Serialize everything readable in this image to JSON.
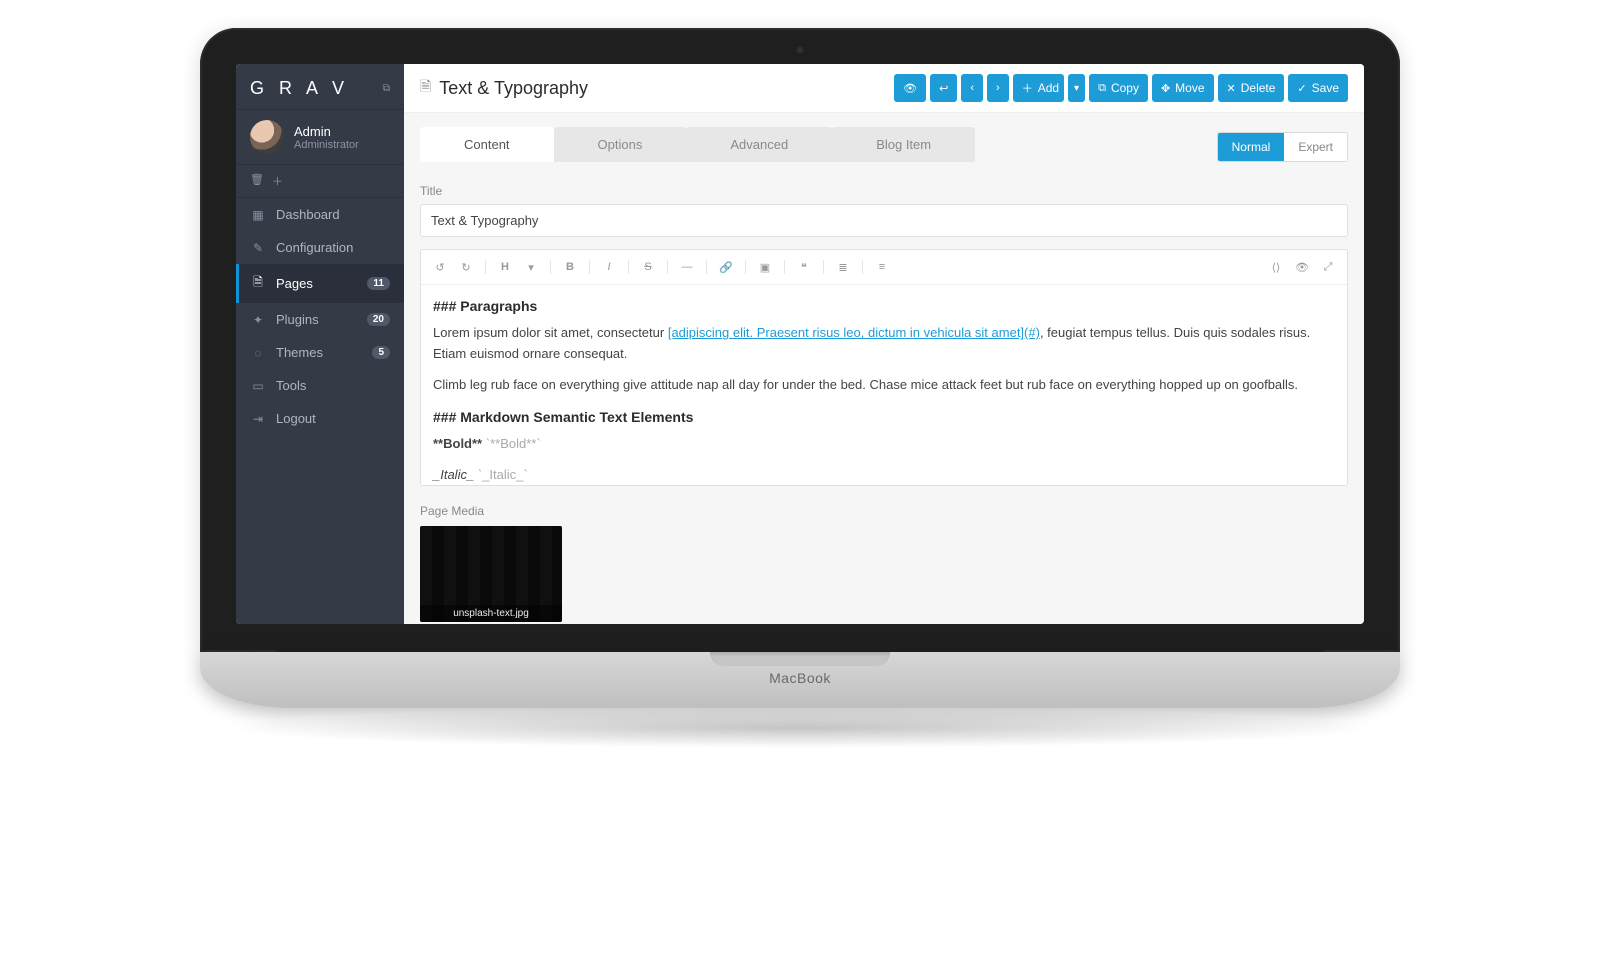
{
  "brand": "G R A V",
  "user": {
    "name": "Admin",
    "role": "Administrator"
  },
  "nav": {
    "dashboard": "Dashboard",
    "configuration": "Configuration",
    "pages": "Pages",
    "pages_count": "11",
    "plugins": "Plugins",
    "plugins_count": "20",
    "themes": "Themes",
    "themes_count": "5",
    "tools": "Tools",
    "logout": "Logout"
  },
  "header": {
    "title": "Text & Typography",
    "buttons": {
      "add": "Add",
      "copy": "Copy",
      "move": "Move",
      "delete": "Delete",
      "save": "Save"
    }
  },
  "tabs": {
    "content": "Content",
    "options": "Options",
    "advanced": "Advanced",
    "blog_item": "Blog Item"
  },
  "mode": {
    "normal": "Normal",
    "expert": "Expert"
  },
  "form": {
    "title_label": "Title",
    "title_value": "Text & Typography",
    "page_media_label": "Page Media"
  },
  "editor": {
    "h1": "### Paragraphs",
    "p1_a": "Lorem ipsum dolor sit amet, consectetur ",
    "p1_link": "[adipiscing elit. Praesent risus leo, dictum in vehicula sit amet](#)",
    "p1_b": ", feugiat tempus tellus. Duis quis sodales risus. Etiam euismod ornare consequat.",
    "p2": "Climb leg rub face on everything give attitude nap all day for under the bed. Chase mice attack feet but rub face on everything hopped up on goofballs.",
    "h2": "### Markdown Semantic Text Elements",
    "bold_md": "**Bold**",
    "bold_code": "`**Bold**`",
    "italic_md": "_Italic_",
    "italic_code": "`_Italic_`"
  },
  "media": {
    "filename": "unsplash-text.jpg"
  },
  "deck_logo": "MacBook"
}
